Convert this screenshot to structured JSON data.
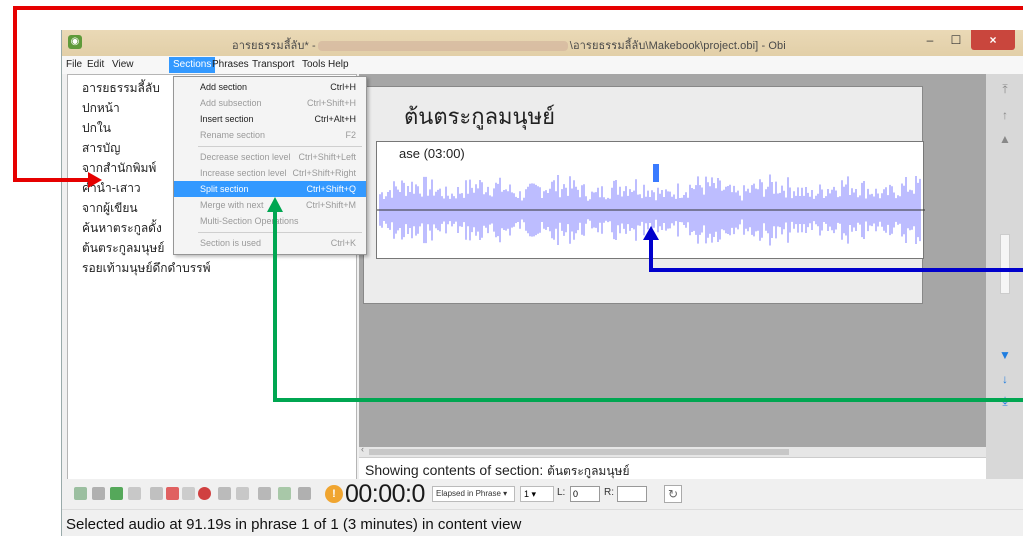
{
  "window": {
    "title_prefix": "อารยธรรมลี้ลับ* -",
    "title_suffix": "\\อารยธรรมลี้ลับ\\Makebook\\project.obi] - Obi",
    "min": "–",
    "max": "☐",
    "close": "×"
  },
  "menu": [
    "File",
    "Edit",
    "View",
    "Sections",
    "Phrases",
    "Transport",
    "Tools",
    "Help"
  ],
  "tree": [
    "อารยธรรมลี้ลับ",
    "ปกหน้า",
    "ปกใน",
    "สารบัญ",
    "จากสำนักพิมพ์",
    "คำนำ-เสาว",
    "จากผู้เขียน",
    "ค้นหาตระกูลดั้ง",
    "ต้นตระกูลมนุษย์",
    "รอยเท้ามนุษย์ดึกดำบรรพ์"
  ],
  "content": {
    "section_title": "ต้นตระกูลมนุษย์",
    "phrase_label": "ase (03:00)",
    "showing_prefix": "Showing contents of section:",
    "showing_section": "ต้นตระกูลมนุษย์"
  },
  "sections_menu": [
    {
      "label": "Add section",
      "shortcut": "Ctrl+H",
      "enabled": true
    },
    {
      "label": "Add subsection",
      "shortcut": "Ctrl+Shift+H",
      "enabled": false
    },
    {
      "label": "Insert section",
      "shortcut": "Ctrl+Alt+H",
      "enabled": true
    },
    {
      "label": "Rename section",
      "shortcut": "F2",
      "enabled": false
    },
    {
      "label": "Decrease section level",
      "shortcut": "Ctrl+Shift+Left",
      "enabled": false
    },
    {
      "label": "Increase section level",
      "shortcut": "Ctrl+Shift+Right",
      "enabled": false
    },
    {
      "label": "Split section",
      "shortcut": "Ctrl+Shift+Q",
      "enabled": true,
      "highlighted": true
    },
    {
      "label": "Merge with next",
      "shortcut": "Ctrl+Shift+M",
      "enabled": false
    },
    {
      "label": "Multi-Section Operations",
      "shortcut": "",
      "enabled": false
    },
    {
      "label": "Section is used",
      "shortcut": "Ctrl+K",
      "enabled": false
    }
  ],
  "transport": {
    "timer": "00:00:0",
    "elapsed_mode": "Elapsed in Phrase",
    "phrase_num": "1",
    "l_label": "L:",
    "l_value": "0",
    "r_label": "R:",
    "r_value": ""
  },
  "status": "Selected audio at 91.19s in phrase 1 of 1 (3 minutes) in content view",
  "colors": {
    "accent": "#3399ff",
    "waveform": "#7b7bff",
    "red_arrow": "#e60000",
    "blue_arrow": "#0000cc",
    "green_arrow": "#00a651"
  }
}
